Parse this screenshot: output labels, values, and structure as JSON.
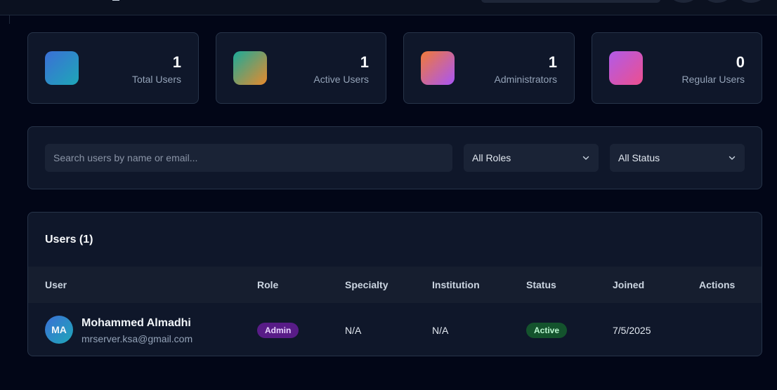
{
  "stats": [
    {
      "value": "1",
      "label": "Total Users",
      "gradient": [
        "#3b6fd6",
        "#1ea7b8"
      ]
    },
    {
      "value": "1",
      "label": "Active Users",
      "gradient": [
        "#1bab9a",
        "#e78a2c"
      ]
    },
    {
      "value": "1",
      "label": "Administrators",
      "gradient": [
        "#f07a38",
        "#a855f7"
      ]
    },
    {
      "value": "0",
      "label": "Regular Users",
      "gradient": [
        "#b15be8",
        "#ec4f8f"
      ]
    }
  ],
  "filters": {
    "search_placeholder": "Search users by name or email...",
    "role_select": "All Roles",
    "status_select": "All Status"
  },
  "users_table": {
    "title": "Users (1)",
    "columns": [
      "User",
      "Role",
      "Specialty",
      "Institution",
      "Status",
      "Joined",
      "Actions"
    ],
    "rows": [
      {
        "initials": "MA",
        "name": "Mohammed Almadhi",
        "email": "mrserver.ksa@gmail.com",
        "role": "Admin",
        "specialty": "N/A",
        "institution": "N/A",
        "status": "Active",
        "joined": "7/5/2025"
      }
    ]
  },
  "colors": {
    "admin_badge_bg": "#581c87",
    "admin_badge_fg": "#e9d5ff",
    "active_badge_bg": "#14532d",
    "active_badge_fg": "#bbf7d0"
  }
}
